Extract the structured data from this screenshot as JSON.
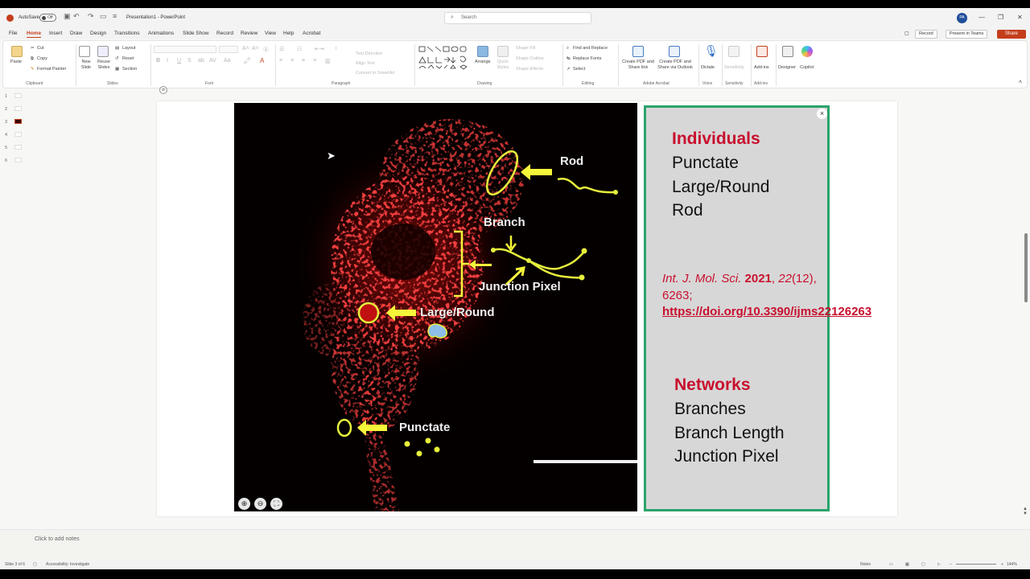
{
  "titlebar": {
    "autosave": "AutoSave",
    "toggle": "Off",
    "doc_title": "Presentation1  -  PowerPoint",
    "search_placeholder": "Search",
    "avatar": "PA"
  },
  "tabs": [
    "File",
    "Home",
    "Insert",
    "Draw",
    "Design",
    "Transitions",
    "Animations",
    "Slide Show",
    "Record",
    "Review",
    "View",
    "Help",
    "Acrobat"
  ],
  "tab_right": {
    "record": "Record",
    "present": "Present in Teams",
    "share": "Share"
  },
  "ribbon": {
    "clipboard": {
      "paste": "Paste",
      "cut": "Cut",
      "copy": "Copy",
      "format_painter": "Format Painter",
      "label": "Clipboard"
    },
    "slides": {
      "new_slide": "New Slide",
      "reuse": "Reuse Slides",
      "layout": "Layout",
      "reset": "Reset",
      "section": "Section",
      "label": "Slides"
    },
    "font": {
      "bold": "B",
      "italic": "I",
      "underline": "U",
      "strike": "S",
      "label": "Font"
    },
    "paragraph": {
      "text_direction": "Text Direction",
      "align_text": "Align Text",
      "smartart": "Convert to SmartArt",
      "label": "Paragraph"
    },
    "drawing": {
      "arrange": "Arrange",
      "quick_styles": "Quick Styles",
      "shape_fill": "Shape Fill",
      "shape_outline": "Shape Outline",
      "shape_effects": "Shape Effects",
      "label": "Drawing"
    },
    "editing": {
      "find": "Find and Replace",
      "replace_fonts": "Replace Fonts",
      "select": "Select",
      "label": "Editing"
    },
    "acrobat": {
      "pdf_share": "Create PDF and Share link",
      "pdf_outlook": "Create PDF and Share via Outlook",
      "label": "Adobe Acrobat"
    },
    "voice": {
      "dictate": "Dictate",
      "label": "Voice"
    },
    "sensitivity": {
      "name": "Sensitivity",
      "label": "Sensitivity"
    },
    "addins": {
      "name": "Add-ins",
      "label": "Add-ins"
    },
    "designer": "Designer",
    "copilot": "Copilot"
  },
  "thumbnails": [
    "1",
    "2",
    "3",
    "4",
    "5",
    "6"
  ],
  "slide": {
    "image_labels": {
      "rod": "Rod",
      "branch": "Branch",
      "junction": "Junction Pixel",
      "large_round": "Large/Round",
      "punctate": "Punctate"
    },
    "panel": {
      "individuals_heading": "Individuals",
      "individuals": [
        "Punctate",
        "Large/Round",
        "Rod"
      ],
      "citation": {
        "journal": "Int. J. Mol. Sci.",
        "year": "2021",
        "volume": "22",
        "issue": "(12),",
        "page": "6263;",
        "doi": "https://doi.org/10.3390/ijms22126263"
      },
      "networks_heading": "Networks",
      "networks": [
        "Branches",
        "Branch Length",
        "Junction Pixel"
      ]
    }
  },
  "notes": {
    "placeholder": "Click to add notes"
  },
  "status": {
    "slide": "Slide 3 of 6",
    "accessibility": "Accessibility: Investigate",
    "notes": "Notes",
    "zoom": "144%"
  },
  "colors": {
    "accent": "#c43e1c",
    "panel_border": "#2aa36b",
    "heading_red": "#c8102e",
    "annotation_yellow": "#e6f03c"
  }
}
